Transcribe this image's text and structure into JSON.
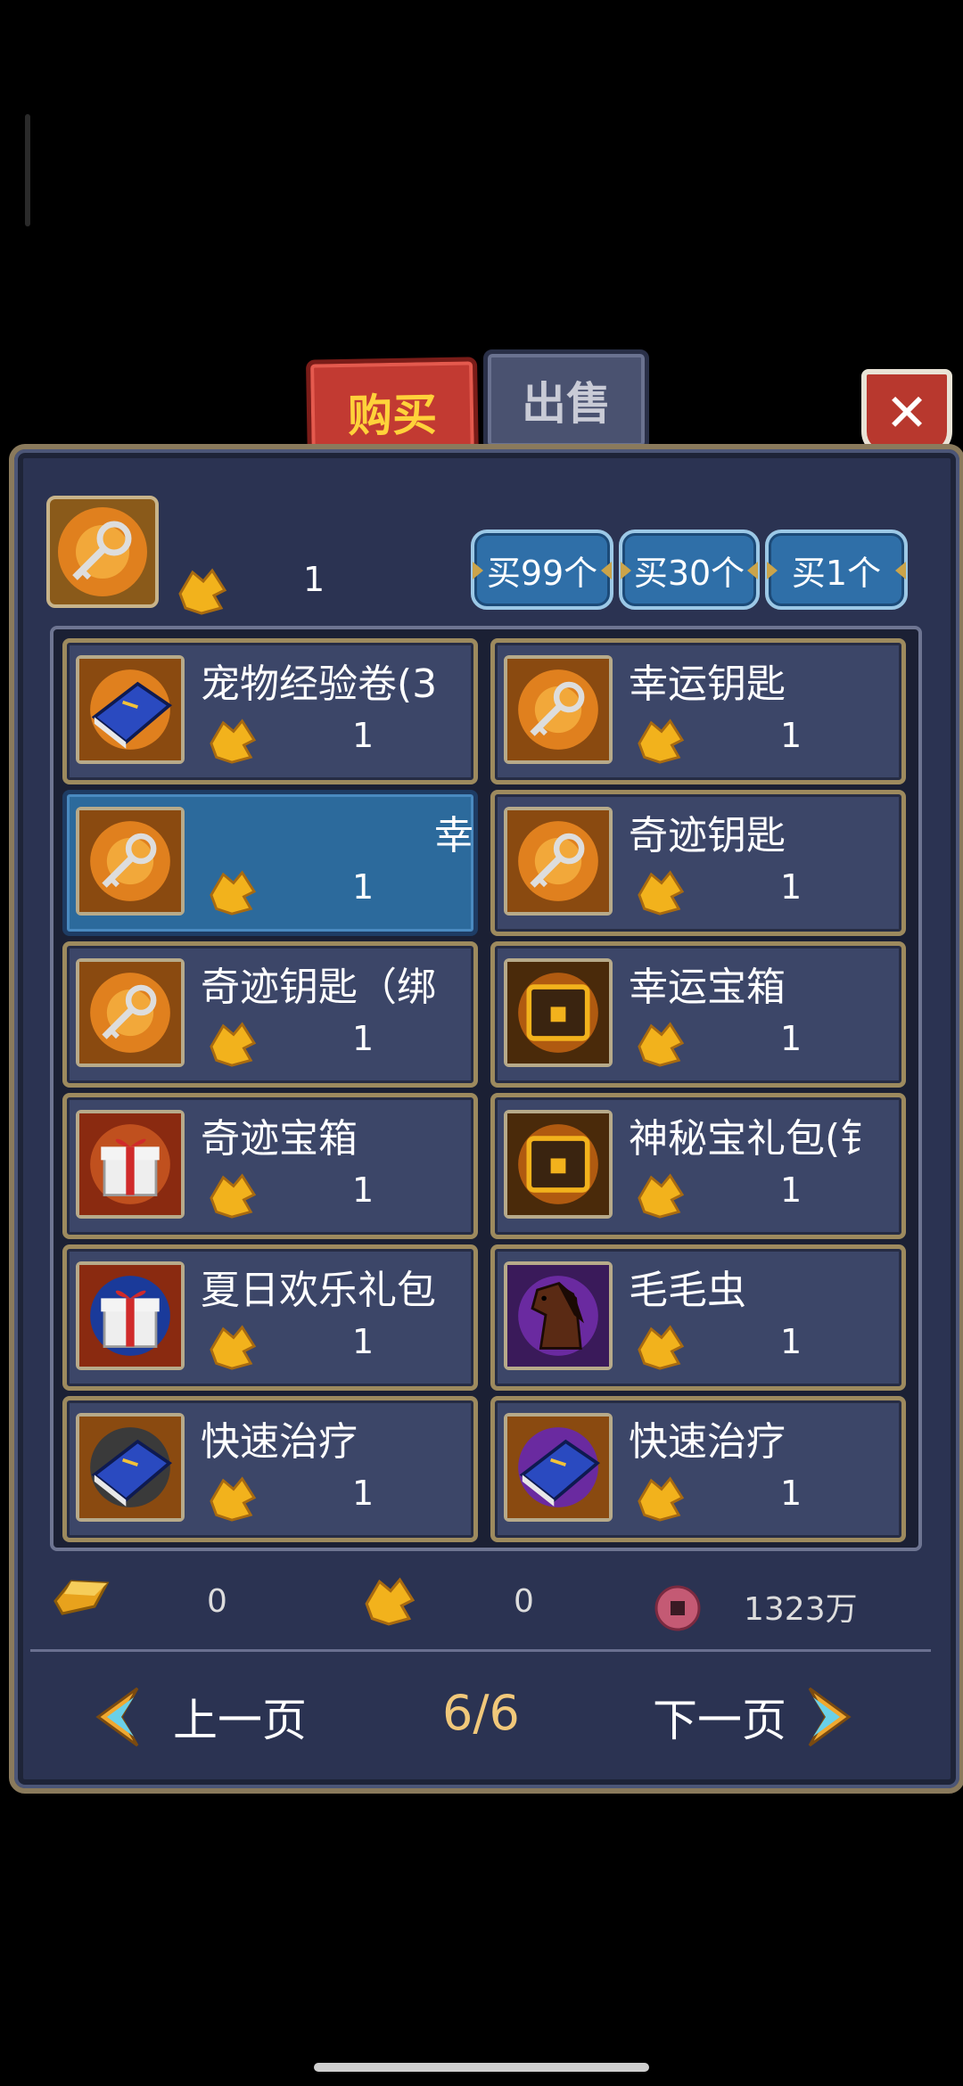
{
  "tabs": {
    "buy": "购买",
    "sell": "出售"
  },
  "selected": {
    "price": "1"
  },
  "buy_buttons": {
    "b99": "买99个",
    "b30": "买30个",
    "b1": "买1个"
  },
  "items": [
    {
      "name": "宠物经验卷(3",
      "price": "1",
      "icon": "blue-book-icon"
    },
    {
      "name": "幸运钥匙",
      "price": "1",
      "icon": "key-icon"
    },
    {
      "name": "幸",
      "price": "1",
      "icon": "key-icon"
    },
    {
      "name": "奇迹钥匙",
      "price": "1",
      "icon": "key-icon"
    },
    {
      "name": "奇迹钥匙（绑",
      "price": "1",
      "icon": "key-icon"
    },
    {
      "name": "幸运宝箱",
      "price": "1",
      "icon": "treasure-chest-icon"
    },
    {
      "name": "奇迹宝箱",
      "price": "1",
      "icon": "gift-box-icon"
    },
    {
      "name": "神秘宝礼包(钅",
      "price": "1",
      "icon": "treasure-chest-icon"
    },
    {
      "name": "夏日欢乐礼包",
      "price": "1",
      "icon": "gift-box-icon"
    },
    {
      "name": "毛毛虫",
      "price": "1",
      "icon": "horse-icon"
    },
    {
      "name": "快速治疗",
      "price": "1",
      "icon": "blue-book-icon"
    },
    {
      "name": "快速治疗",
      "price": "1",
      "icon": "blue-book-icon"
    }
  ],
  "currency": {
    "gold": "0",
    "leaf": "0",
    "coin": "1323万"
  },
  "pagination": {
    "prev": "上一页",
    "page": "6/6",
    "next": "下一页"
  },
  "colors": {
    "panel": "#2b3352",
    "selected": "#2c6a9c",
    "accent_gold": "#f1c87a"
  }
}
